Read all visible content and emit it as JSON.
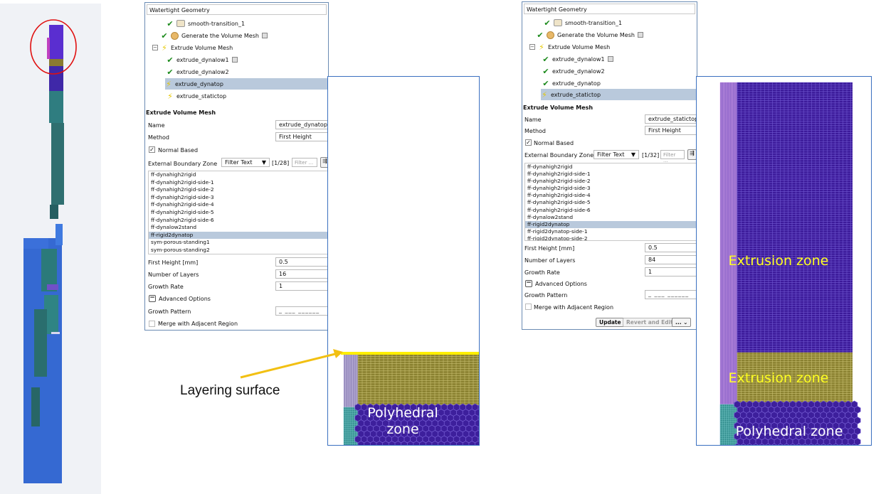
{
  "left_panel": {
    "title": "Watertight Geometry",
    "tree": [
      {
        "label": "smooth-transition_1",
        "status": "done",
        "icon": "surface-icon"
      },
      {
        "label": "Generate the Volume Mesh",
        "status": "done",
        "icon": "volume-mesh-icon"
      },
      {
        "label": "Extrude Volume Mesh",
        "status": "pending",
        "icon": "expander"
      },
      {
        "label": "extrude_dynalow1",
        "status": "done"
      },
      {
        "label": "extrude_dynalow2",
        "status": "done"
      },
      {
        "label": "extrude_dynatop",
        "status": "pending",
        "selected": true
      },
      {
        "label": "extrude_statictop",
        "status": "pending"
      }
    ],
    "form": {
      "section_title": "Extrude Volume Mesh",
      "name_label": "Name",
      "name_value": "extrude_dynatop",
      "method_label": "Method",
      "method_value": "First Height",
      "normal_based_label": "Normal Based",
      "normal_based_checked": true,
      "ext_zone_label": "External Boundary Zone",
      "filter_type": "Filter Text",
      "count": "[1/28]",
      "filter_placeholder": "Filter ...",
      "zones": [
        "ff-dynahigh2rigid",
        "ff-dynahigh2rigid-side-1",
        "ff-dynahigh2rigid-side-2",
        "ff-dynahigh2rigid-side-3",
        "ff-dynahigh2rigid-side-4",
        "ff-dynahigh2rigid-side-5",
        "ff-dynahigh2rigid-side-6",
        "ff-dynalow2stand",
        "ff-rigid2dynatop",
        "sym-porous-standing1",
        "sym-porous-standing2"
      ],
      "selected_zone": "ff-rigid2dynatop",
      "first_height_label": "First Height [mm]",
      "first_height_value": "0.5",
      "layers_label": "Number of Layers",
      "layers_value": "16",
      "growth_rate_label": "Growth Rate",
      "growth_rate_value": "1",
      "advanced_label": "Advanced Options",
      "growth_pattern_label": "Growth Pattern",
      "growth_pattern_value": "_ ___ ______ ___",
      "merge_label": "Merge with Adjacent Region"
    }
  },
  "right_panel": {
    "title": "Watertight Geometry",
    "tree": [
      {
        "label": "smooth-transition_1",
        "status": "done",
        "icon": "surface-icon"
      },
      {
        "label": "Generate the Volume Mesh",
        "status": "done",
        "icon": "volume-mesh-icon"
      },
      {
        "label": "Extrude Volume Mesh",
        "status": "pending",
        "icon": "expander"
      },
      {
        "label": "extrude_dynalow1",
        "status": "done"
      },
      {
        "label": "extrude_dynalow2",
        "status": "done"
      },
      {
        "label": "extrude_dynatop",
        "status": "done"
      },
      {
        "label": "extrude_statictop",
        "status": "pending",
        "selected": true
      }
    ],
    "form": {
      "section_title": "Extrude Volume Mesh",
      "name_label": "Name",
      "name_value": "extrude_statictop",
      "method_label": "Method",
      "method_value": "First Height",
      "normal_based_label": "Normal Based",
      "normal_based_checked": true,
      "ext_zone_label": "External Boundary Zone",
      "filter_type": "Filter Text",
      "count": "[1/32]",
      "filter_placeholder": "Filter ...",
      "zones": [
        "ff-dynahigh2rigid",
        "ff-dynahigh2rigid-side-1",
        "ff-dynahigh2rigid-side-2",
        "ff-dynahigh2rigid-side-3",
        "ff-dynahigh2rigid-side-4",
        "ff-dynahigh2rigid-side-5",
        "ff-dynahigh2rigid-side-6",
        "ff-dynalow2stand",
        "ff-rigid2dynatop",
        "ff-rigid2dynatop-side-1",
        "ff-rigid2dynatop-side-2"
      ],
      "selected_zone": "ff-rigid2dynatop",
      "first_height_label": "First Height [mm]",
      "first_height_value": "0.5",
      "layers_label": "Number of Layers",
      "layers_value": "84",
      "growth_rate_label": "Growth Rate",
      "growth_rate_value": "1",
      "advanced_label": "Advanced Options",
      "growth_pattern_label": "Growth Pattern",
      "growth_pattern_value": "_ ___ ______ ___",
      "merge_label": "Merge with Adjacent Region",
      "update_label": "Update",
      "revert_label": "Revert and Edit",
      "more_label": "... ⌄"
    }
  },
  "annotations": {
    "layering_surface": "Layering surface",
    "mesh1_zone": "Polyhedral zone",
    "mesh2_extrusion_top": "Extrusion zone",
    "mesh2_extrusion_mid": "Extrusion zone",
    "mesh2_polyhedral": "Polyhedral zone"
  },
  "colors": {
    "mesh_purple": "#3c1a9a",
    "mesh_olive": "#8a8130",
    "mesh_teal": "#2e8a8a",
    "geo_blue": "#3366cc",
    "highlight_circle": "#e01010",
    "arrow_yellow": "#f2c012",
    "selection": "#b9c9dc"
  }
}
